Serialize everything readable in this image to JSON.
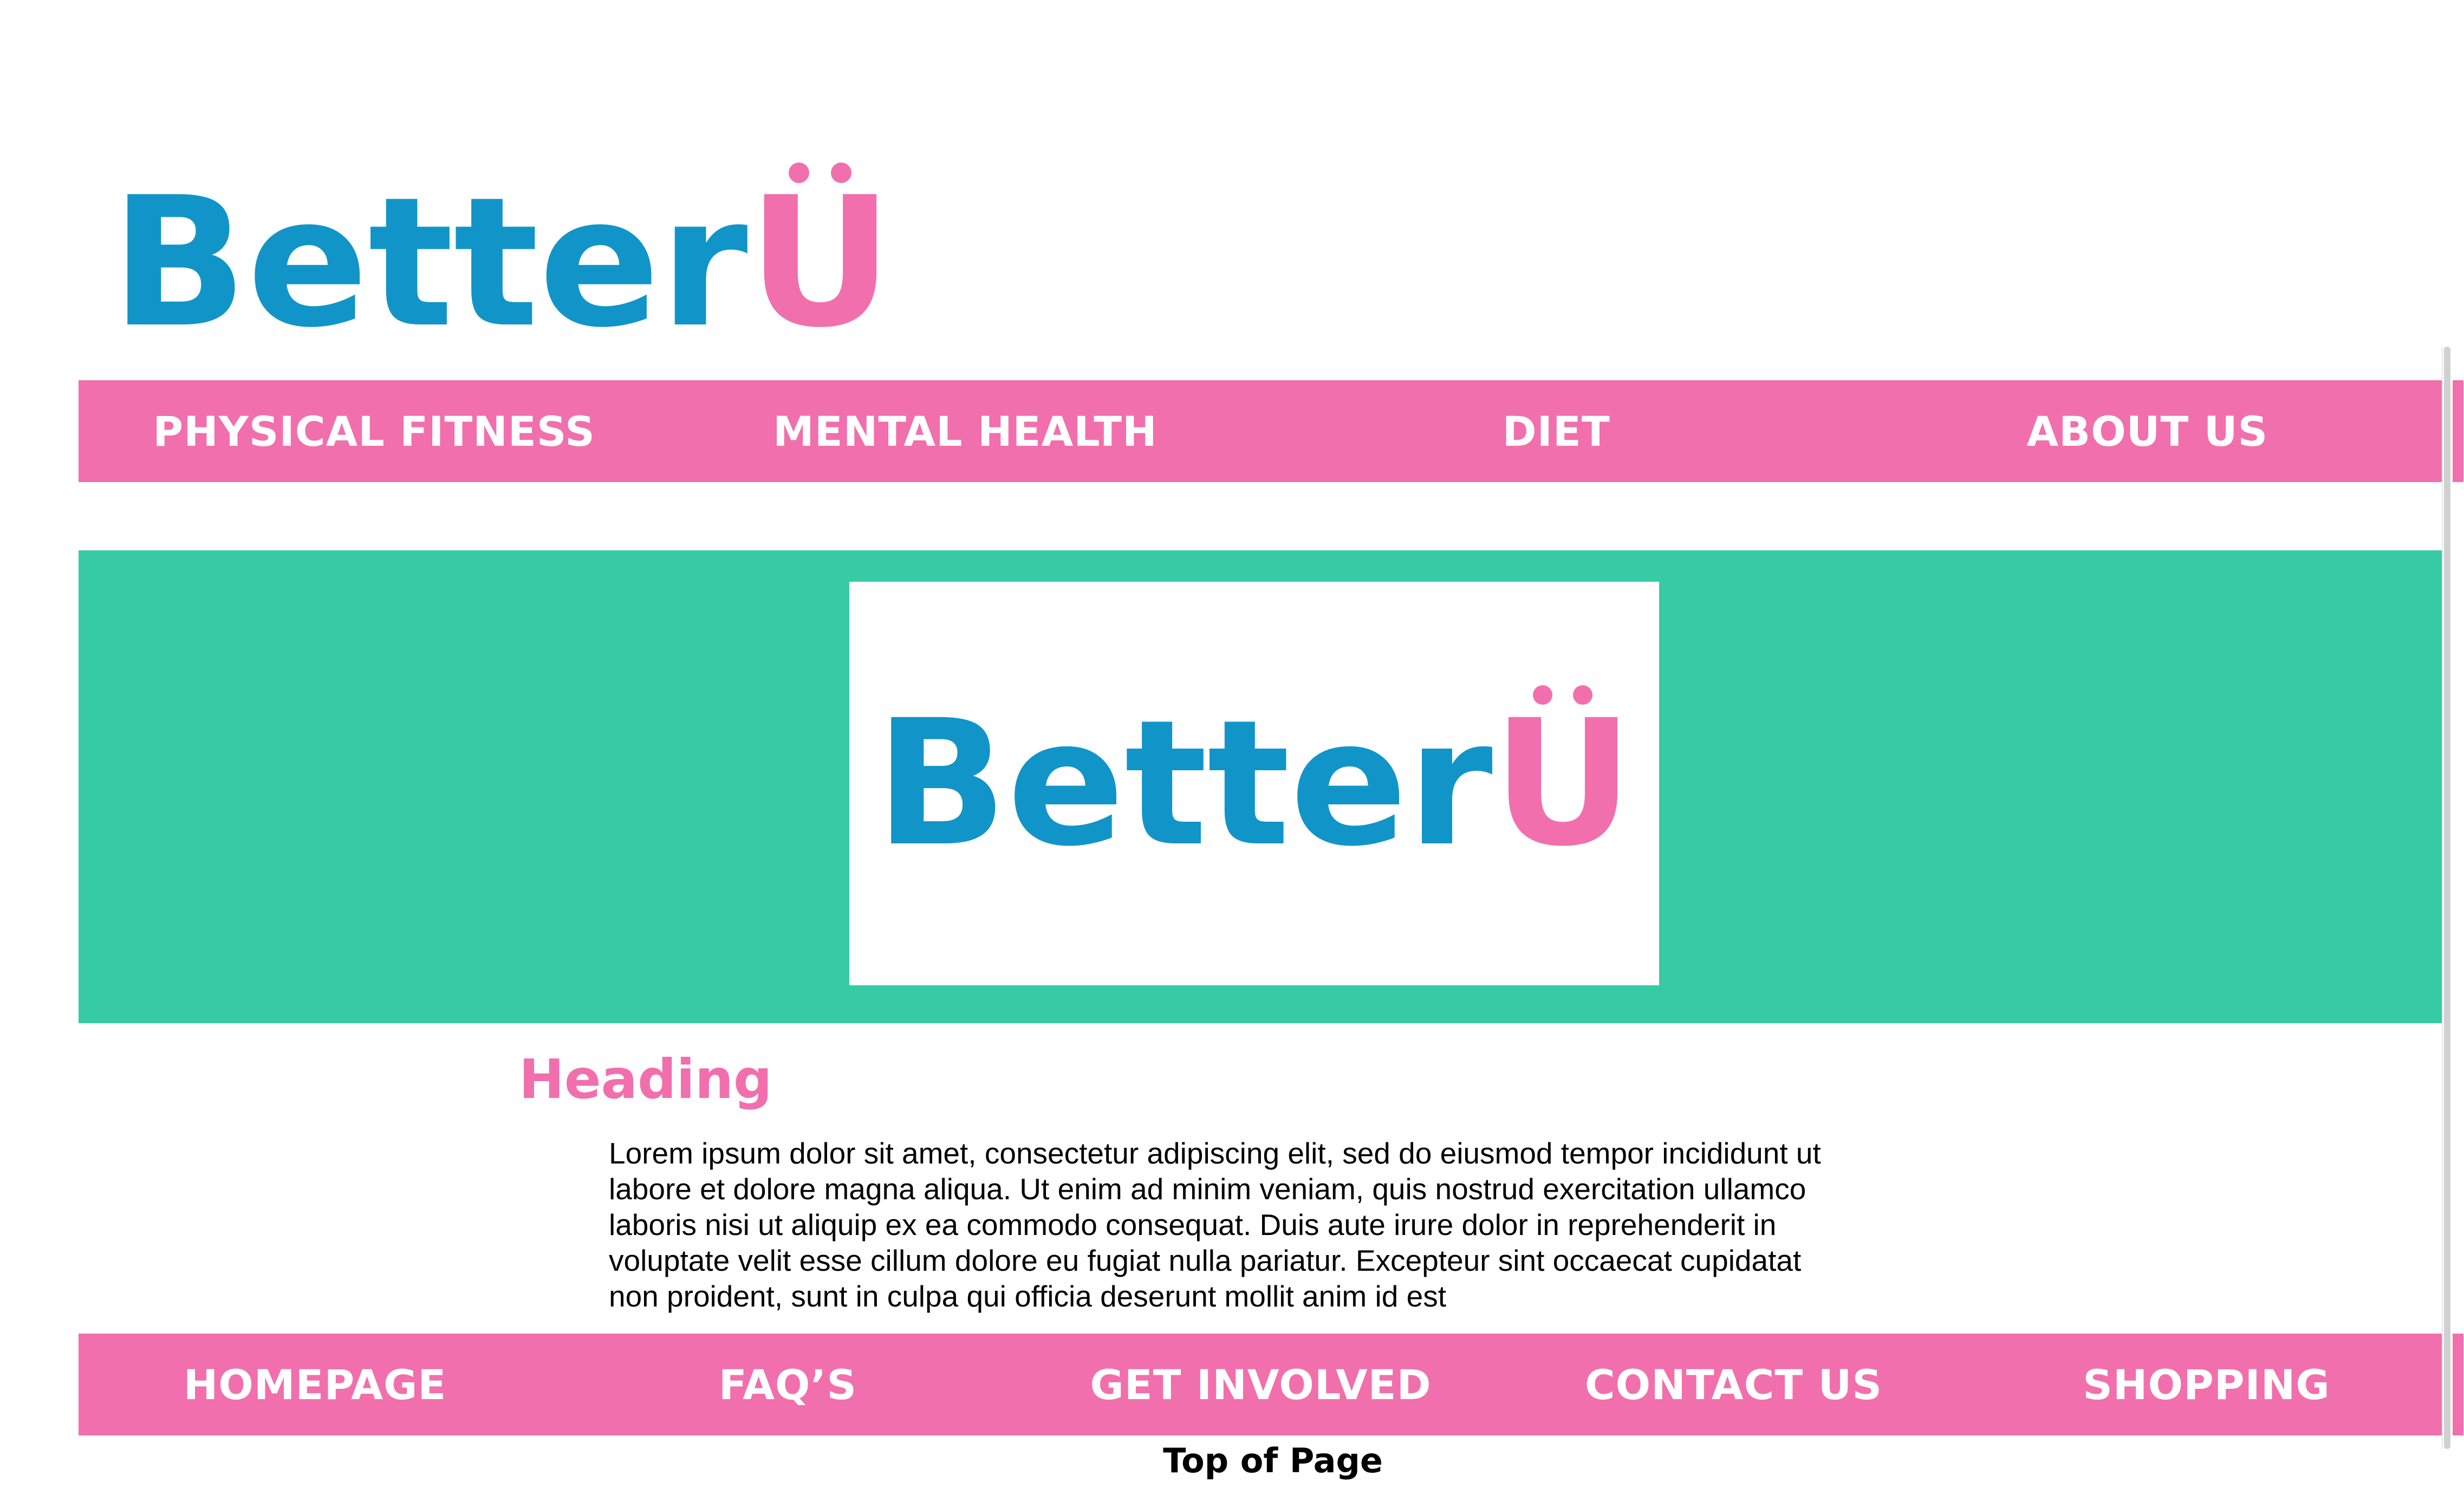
{
  "brand": {
    "logo_word": "Better",
    "logo_letter": "U",
    "colors": {
      "blue": "#1195c9",
      "pink": "#f16fac",
      "teal": "#37cba5"
    }
  },
  "top_nav": {
    "items": [
      {
        "label": "PHYSICAL FITNESS"
      },
      {
        "label": "MENTAL HEALTH"
      },
      {
        "label": "DIET"
      },
      {
        "label": "ABOUT US"
      }
    ]
  },
  "hero": {
    "logo_word": "Better",
    "logo_letter": "U"
  },
  "content": {
    "heading": "Heading",
    "body": "Lorem ipsum dolor sit amet, consectetur adipiscing elit, sed do eiusmod tempor incididunt ut labore et dolore magna aliqua. Ut enim ad minim veniam, quis nostrud exercitation ullamco laboris nisi ut aliquip ex ea commodo consequat. Duis aute irure dolor in reprehenderit in voluptate velit esse cillum dolore eu fugiat nulla pariatur. Excepteur sint occaecat cupidatat non proident, sunt in culpa qui officia deserunt mollit anim id est"
  },
  "bottom_nav": {
    "items": [
      {
        "label": "HOMEPAGE"
      },
      {
        "label": "FAQ’S"
      },
      {
        "label": "GET INVOLVED"
      },
      {
        "label": "CONTACT US"
      },
      {
        "label": "SHOPPING"
      }
    ]
  },
  "footer": {
    "top_of_page": "Top of Page"
  }
}
